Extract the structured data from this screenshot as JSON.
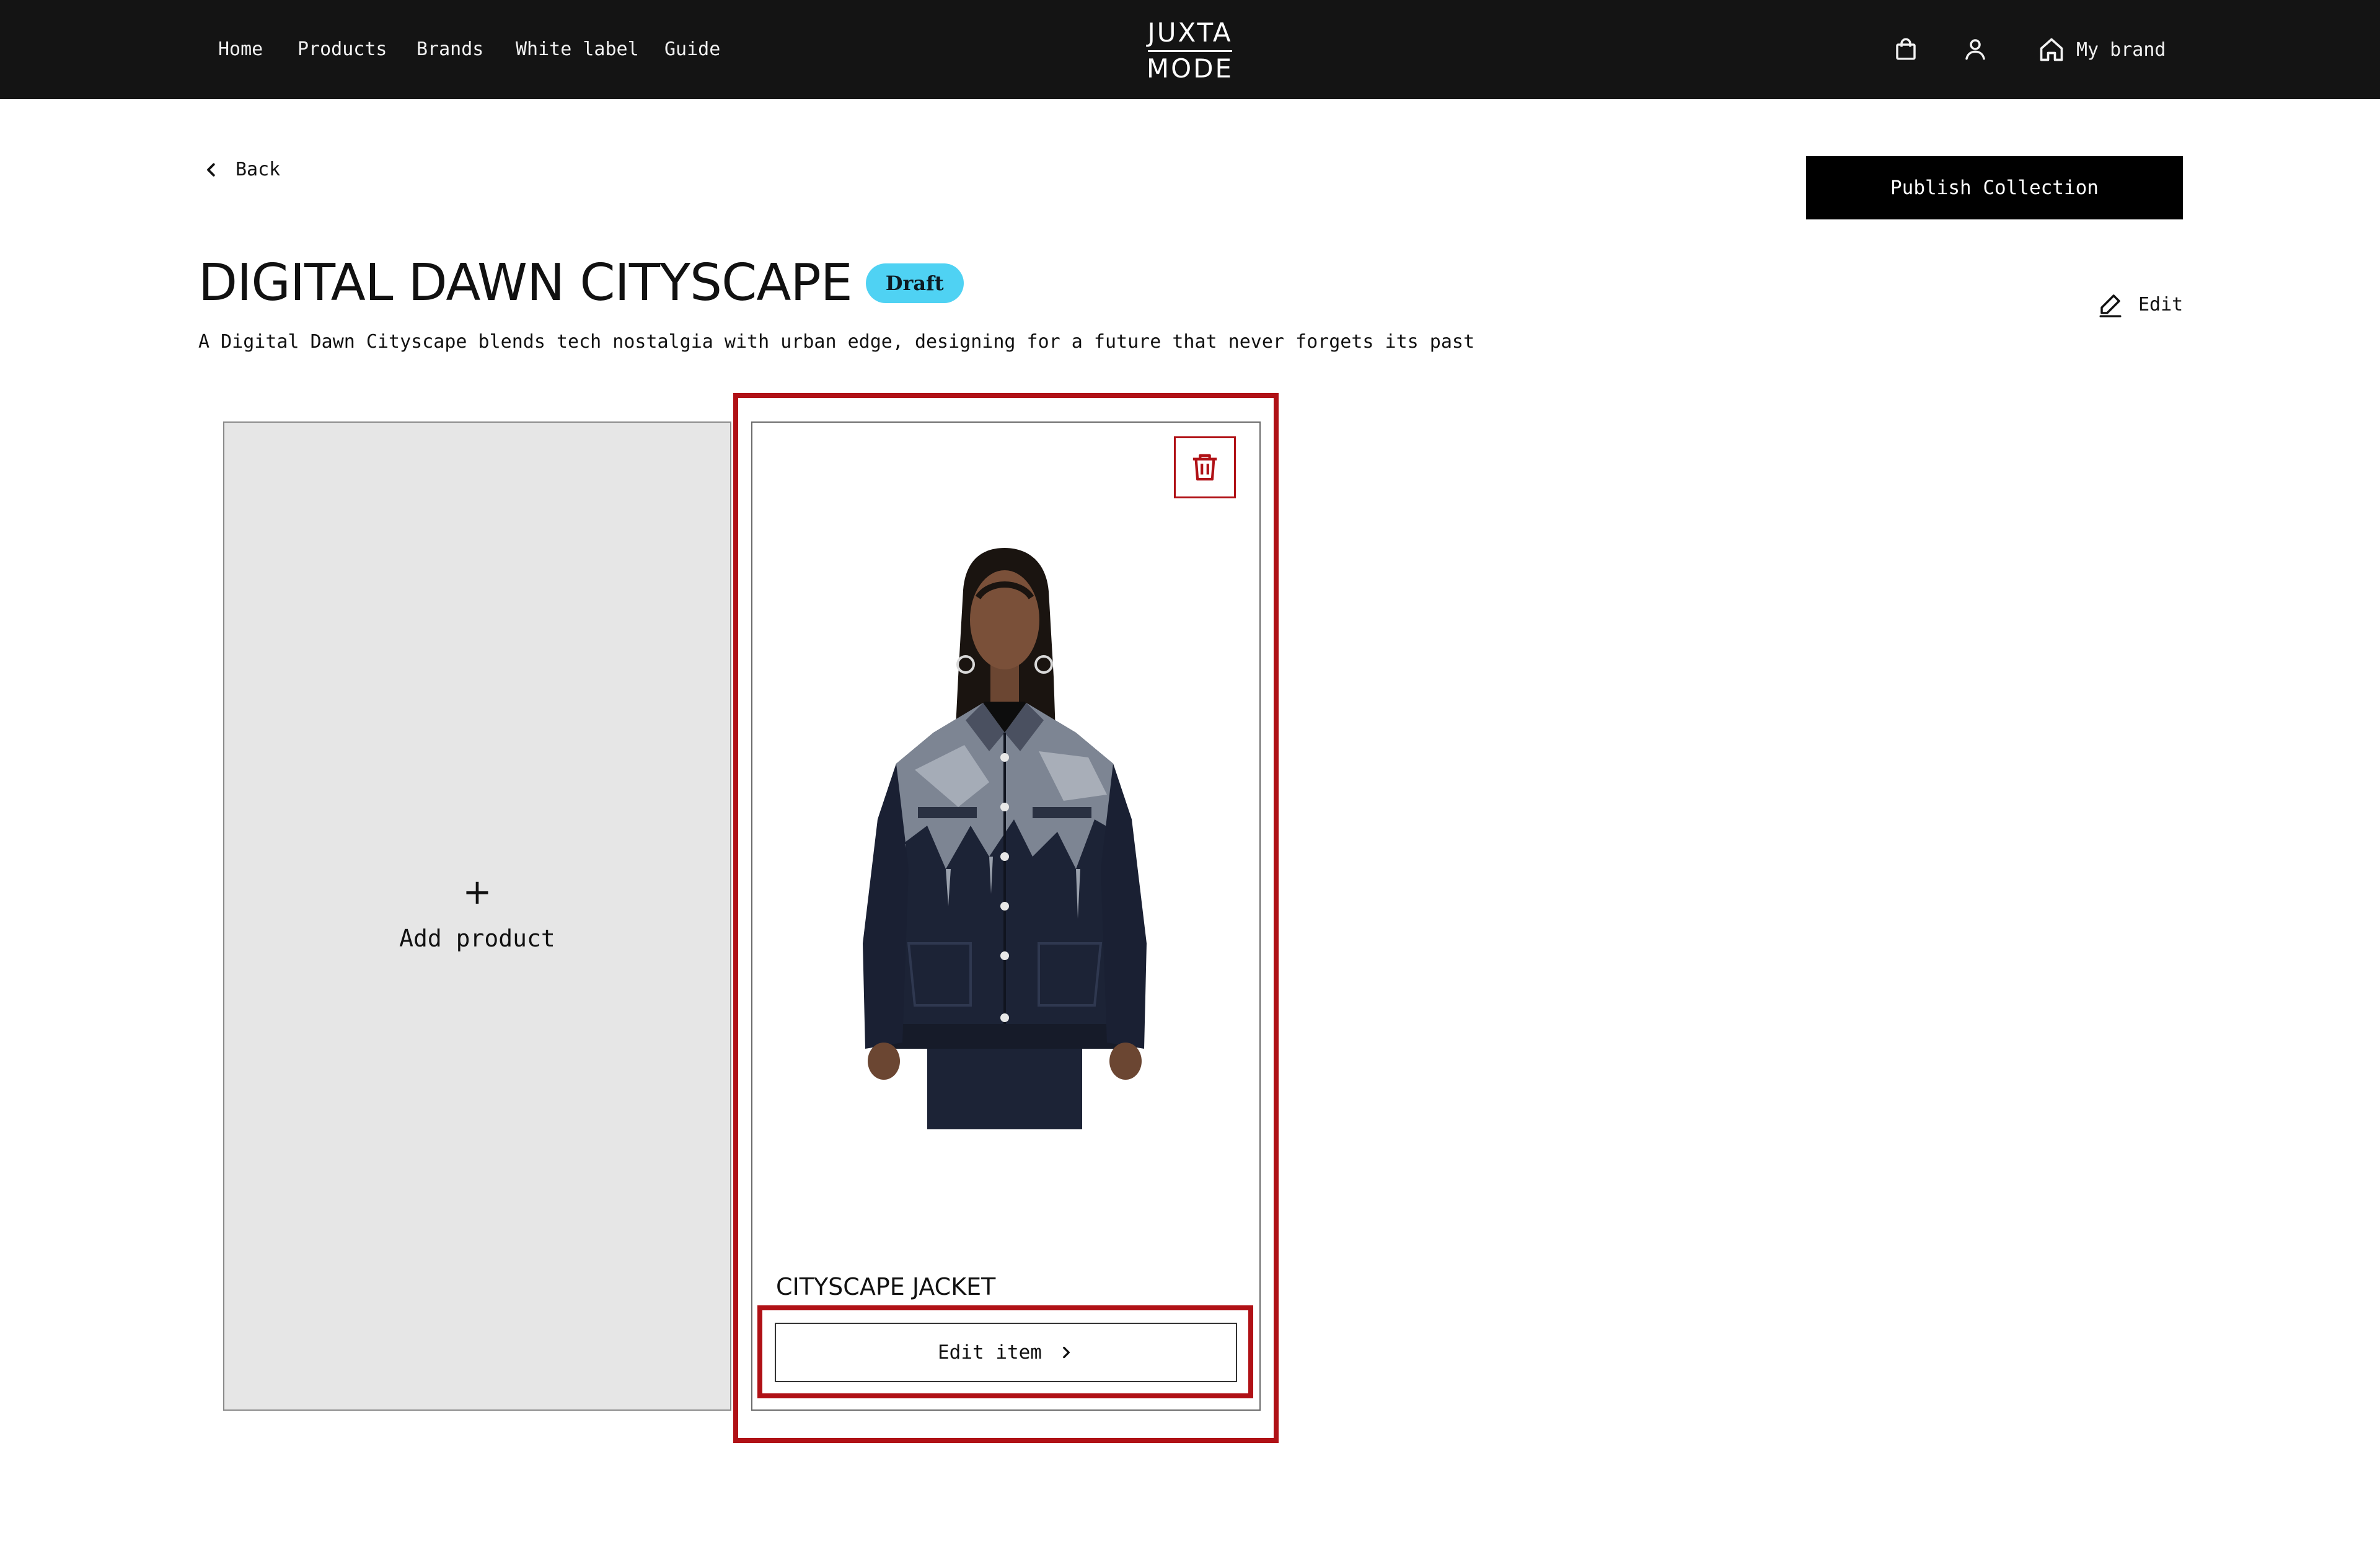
{
  "nav": {
    "links": [
      "Home",
      "Products",
      "Brands",
      "White label",
      "Guide"
    ],
    "logo_top": "JUXTA",
    "logo_bottom": "MODE",
    "my_brand_label": "My brand",
    "icons": [
      "bag-icon",
      "user-icon",
      "home-icon"
    ]
  },
  "page": {
    "back_label": "Back",
    "publish_label": "Publish Collection",
    "title": "DIGITAL DAWN CITYSCAPE",
    "status_badge": "Draft",
    "edit_label": "Edit",
    "description": "A Digital Dawn Cityscape blends tech nostalgia with urban edge, designing for a future that never forgets its past"
  },
  "add_card": {
    "plus": "+",
    "label": "Add product"
  },
  "products": [
    {
      "name": "CITYSCAPE JACKET",
      "edit_label": "Edit item"
    }
  ],
  "colors": {
    "topbar": "#141414",
    "badge": "#4fd2f3",
    "highlight": "#b01116",
    "add_card_bg": "#e6e6e6"
  }
}
